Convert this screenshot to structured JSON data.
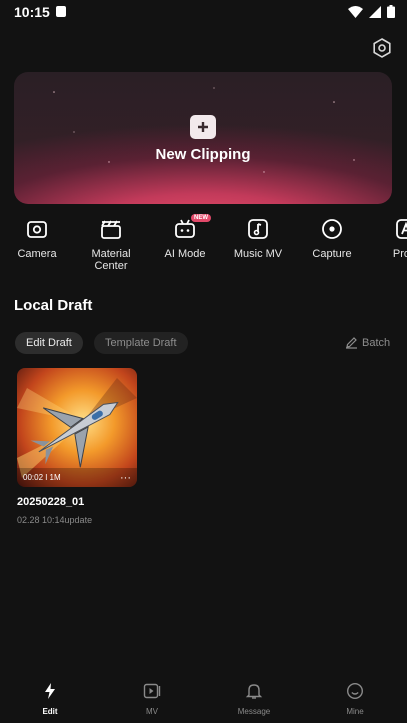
{
  "status_bar": {
    "time": "10:15"
  },
  "hero": {
    "title": "New Clipping"
  },
  "tools": [
    {
      "label": "Camera",
      "icon": "camera-icon"
    },
    {
      "label": "Material Center",
      "icon": "clapperboard-icon"
    },
    {
      "label": "AI Mode",
      "icon": "ai-robot-icon",
      "badge": "NEW"
    },
    {
      "label": "Music MV",
      "icon": "music-note-icon"
    },
    {
      "label": "Capture",
      "icon": "capture-icon"
    },
    {
      "label": "Prom",
      "icon": "prompt-icon"
    }
  ],
  "local_draft": {
    "title": "Local Draft",
    "tabs": [
      "Edit Draft",
      "Template Draft"
    ],
    "batch_label": "Batch",
    "drafts": [
      {
        "name": "20250228_01",
        "date": "02.28 10:14update",
        "duration": "00:02 ǀ 1M",
        "more": "···"
      }
    ]
  },
  "bottom_nav": [
    {
      "label": "Edit",
      "icon": "bolt-icon",
      "active": true
    },
    {
      "label": "MV",
      "icon": "play-icon"
    },
    {
      "label": "Message",
      "icon": "bell-icon"
    },
    {
      "label": "Mine",
      "icon": "smiley-icon"
    }
  ],
  "colors": {
    "background": "#121212",
    "accent": "#e24a6a"
  }
}
